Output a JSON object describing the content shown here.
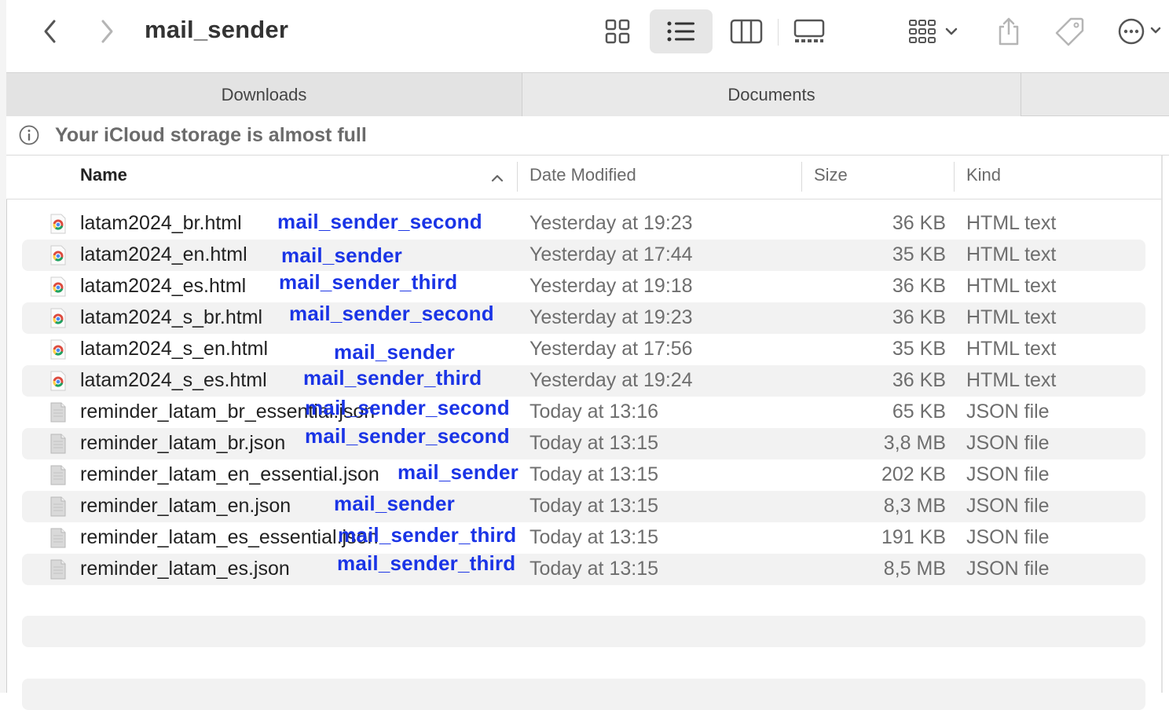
{
  "window": {
    "title": "mail_sender"
  },
  "toolbar": {
    "back_icon": "chevron-left-icon",
    "forward_icon": "chevron-right-icon",
    "view_icons": [
      "grid-view-icon",
      "list-view-icon",
      "column-view-icon",
      "gallery-view-icon"
    ],
    "group_icon": "group-by-icon",
    "share_icon": "share-icon",
    "tag_icon": "tag-icon",
    "more_icon": "more-icon"
  },
  "tabs": [
    "Downloads",
    "Documents"
  ],
  "banner": {
    "icon": "info-icon",
    "text": "Your iCloud storage is almost full"
  },
  "columns": {
    "name": "Name",
    "date": "Date Modified",
    "size": "Size",
    "kind": "Kind"
  },
  "files": [
    {
      "name": "latam2024_br.html",
      "date": "Yesterday at 19:23",
      "size": "36 KB",
      "kind": "HTML text",
      "type": "html",
      "label": "mail_sender_second"
    },
    {
      "name": "latam2024_en.html",
      "date": "Yesterday at 17:44",
      "size": "35 KB",
      "kind": "HTML text",
      "type": "html",
      "label": "mail_sender"
    },
    {
      "name": "latam2024_es.html",
      "date": "Yesterday at 19:18",
      "size": "36 KB",
      "kind": "HTML text",
      "type": "html",
      "label": "mail_sender_third"
    },
    {
      "name": "latam2024_s_br.html",
      "date": "Yesterday at 19:23",
      "size": "36 KB",
      "kind": "HTML text",
      "type": "html",
      "label": "mail_sender_second"
    },
    {
      "name": "latam2024_s_en.html",
      "date": "Yesterday at 17:56",
      "size": "35 KB",
      "kind": "HTML text",
      "type": "html",
      "label": "mail_sender"
    },
    {
      "name": "latam2024_s_es.html",
      "date": "Yesterday at 19:24",
      "size": "36 KB",
      "kind": "HTML text",
      "type": "html",
      "label": "mail_sender_third"
    },
    {
      "name": "reminder_latam_br_essential.json",
      "date": "Today at 13:16",
      "size": "65 KB",
      "kind": "JSON file",
      "type": "json",
      "label": "mail_sender_second"
    },
    {
      "name": "reminder_latam_br.json",
      "date": "Today at 13:15",
      "size": "3,8 MB",
      "kind": "JSON file",
      "type": "json",
      "label": "mail_sender_second"
    },
    {
      "name": "reminder_latam_en_essential.json",
      "date": "Today at 13:15",
      "size": "202 KB",
      "kind": "JSON file",
      "type": "json",
      "label": "mail_sender"
    },
    {
      "name": "reminder_latam_en.json",
      "date": "Today at 13:15",
      "size": "8,3 MB",
      "kind": "JSON file",
      "type": "json",
      "label": "mail_sender"
    },
    {
      "name": "reminder_latam_es_essential.json",
      "date": "Today at 13:15",
      "size": "191 KB",
      "kind": "JSON file",
      "type": "json",
      "label": "mail_sender_third"
    },
    {
      "name": "reminder_latam_es.json",
      "date": "Today at 13:15",
      "size": "8,5 MB",
      "kind": "JSON file",
      "type": "json",
      "label": "mail_sender_third"
    }
  ],
  "colors": {
    "annotation": "#1a34e6",
    "row_alt": "#f2f2f2"
  }
}
